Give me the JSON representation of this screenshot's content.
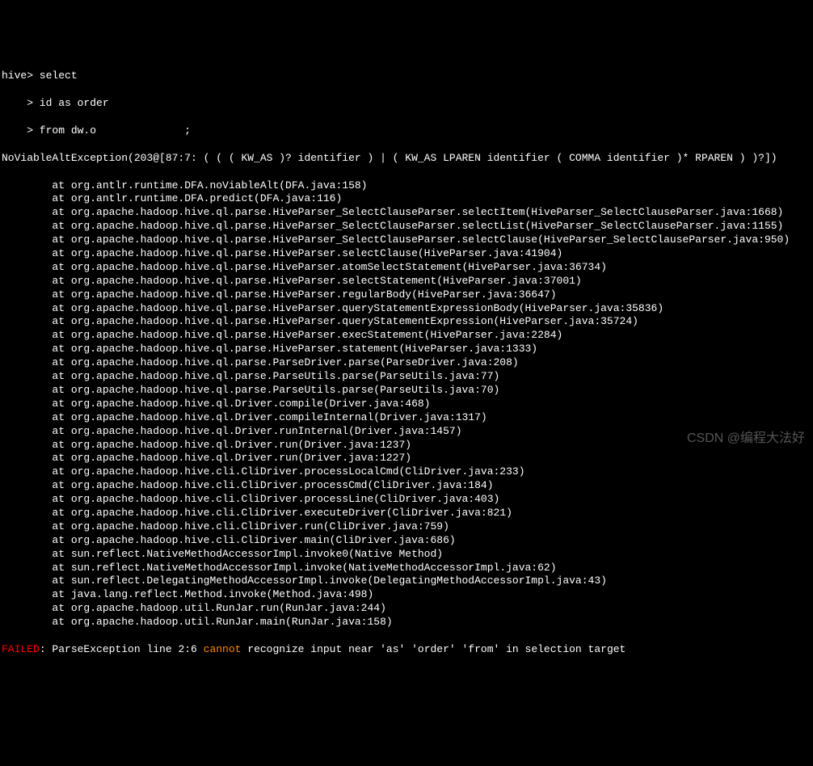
{
  "prompt": {
    "line1": "hive> select",
    "line2": "    > id as order",
    "line3": "    > from dw.o              ;"
  },
  "exception": "NoViableAltException(203@[87:7: ( ( ( KW_AS )? identifier ) | ( KW_AS LPAREN identifier ( COMMA identifier )* RPAREN ) )?])",
  "stack": [
    "        at org.antlr.runtime.DFA.noViableAlt(DFA.java:158)",
    "        at org.antlr.runtime.DFA.predict(DFA.java:116)",
    "        at org.apache.hadoop.hive.ql.parse.HiveParser_SelectClauseParser.selectItem(HiveParser_SelectClauseParser.java:1668)",
    "        at org.apache.hadoop.hive.ql.parse.HiveParser_SelectClauseParser.selectList(HiveParser_SelectClauseParser.java:1155)",
    "        at org.apache.hadoop.hive.ql.parse.HiveParser_SelectClauseParser.selectClause(HiveParser_SelectClauseParser.java:950)",
    "        at org.apache.hadoop.hive.ql.parse.HiveParser.selectClause(HiveParser.java:41904)",
    "        at org.apache.hadoop.hive.ql.parse.HiveParser.atomSelectStatement(HiveParser.java:36734)",
    "        at org.apache.hadoop.hive.ql.parse.HiveParser.selectStatement(HiveParser.java:37001)",
    "        at org.apache.hadoop.hive.ql.parse.HiveParser.regularBody(HiveParser.java:36647)",
    "        at org.apache.hadoop.hive.ql.parse.HiveParser.queryStatementExpressionBody(HiveParser.java:35836)",
    "        at org.apache.hadoop.hive.ql.parse.HiveParser.queryStatementExpression(HiveParser.java:35724)",
    "        at org.apache.hadoop.hive.ql.parse.HiveParser.execStatement(HiveParser.java:2284)",
    "        at org.apache.hadoop.hive.ql.parse.HiveParser.statement(HiveParser.java:1333)",
    "        at org.apache.hadoop.hive.ql.parse.ParseDriver.parse(ParseDriver.java:208)",
    "        at org.apache.hadoop.hive.ql.parse.ParseUtils.parse(ParseUtils.java:77)",
    "        at org.apache.hadoop.hive.ql.parse.ParseUtils.parse(ParseUtils.java:70)",
    "        at org.apache.hadoop.hive.ql.Driver.compile(Driver.java:468)",
    "        at org.apache.hadoop.hive.ql.Driver.compileInternal(Driver.java:1317)",
    "        at org.apache.hadoop.hive.ql.Driver.runInternal(Driver.java:1457)",
    "        at org.apache.hadoop.hive.ql.Driver.run(Driver.java:1237)",
    "        at org.apache.hadoop.hive.ql.Driver.run(Driver.java:1227)",
    "        at org.apache.hadoop.hive.cli.CliDriver.processLocalCmd(CliDriver.java:233)",
    "        at org.apache.hadoop.hive.cli.CliDriver.processCmd(CliDriver.java:184)",
    "        at org.apache.hadoop.hive.cli.CliDriver.processLine(CliDriver.java:403)",
    "        at org.apache.hadoop.hive.cli.CliDriver.executeDriver(CliDriver.java:821)",
    "        at org.apache.hadoop.hive.cli.CliDriver.run(CliDriver.java:759)",
    "        at org.apache.hadoop.hive.cli.CliDriver.main(CliDriver.java:686)",
    "        at sun.reflect.NativeMethodAccessorImpl.invoke0(Native Method)",
    "        at sun.reflect.NativeMethodAccessorImpl.invoke(NativeMethodAccessorImpl.java:62)",
    "        at sun.reflect.DelegatingMethodAccessorImpl.invoke(DelegatingMethodAccessorImpl.java:43)",
    "        at java.lang.reflect.Method.invoke(Method.java:498)",
    "        at org.apache.hadoop.util.RunJar.run(RunJar.java:244)",
    "        at org.apache.hadoop.util.RunJar.main(RunJar.java:158)"
  ],
  "error": {
    "failed": "FAILED",
    "colon": ": ",
    "parse_prefix": "ParseException line 2:6 ",
    "cannot": "cannot",
    "parse_suffix": " recognize input near 'as' 'order' 'from' in selection target"
  },
  "watermark": "CSDN @编程大法好"
}
